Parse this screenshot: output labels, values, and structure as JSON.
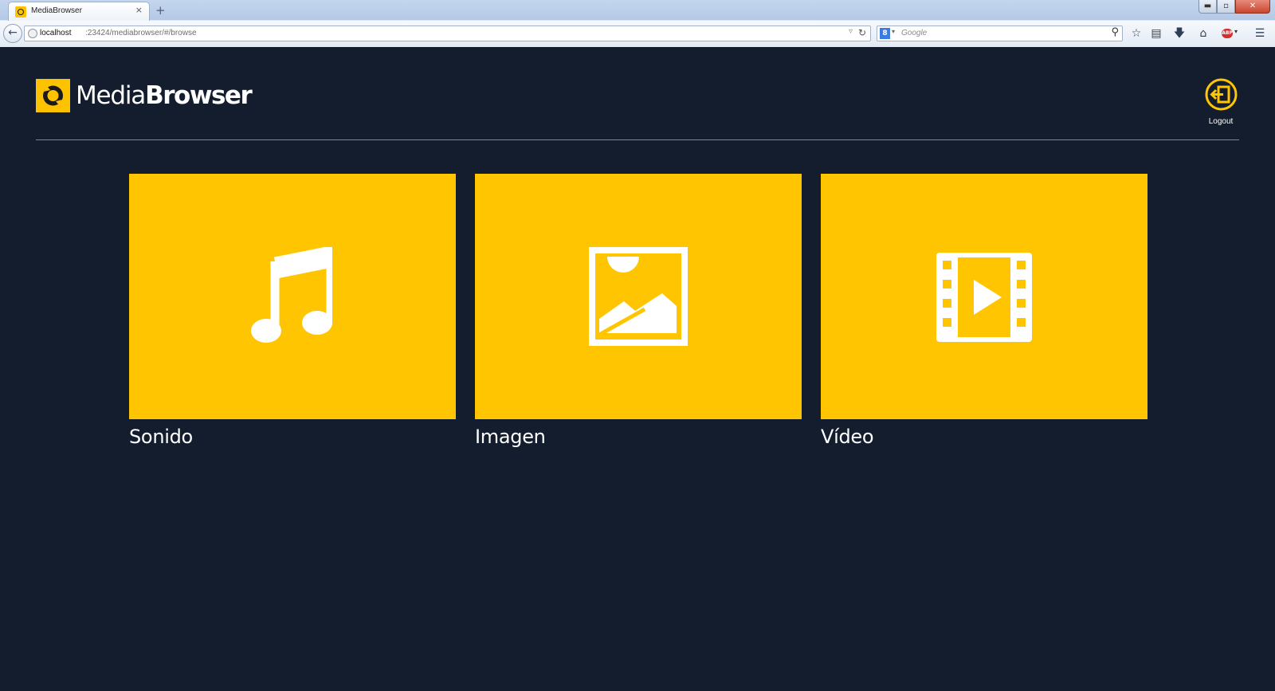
{
  "browser": {
    "tab_title": "MediaBrowser",
    "tab_close": "×",
    "new_tab": "+",
    "url_host": "localhost",
    "url_path": ":23424/mediabrowser/#/browse",
    "search_engine_badge": "8",
    "search_placeholder": "Google",
    "window_buttons": {
      "minimize": "▬",
      "maximize": "▫",
      "close": "✕"
    },
    "toolbar_icons": [
      "star-icon",
      "reading-list-icon",
      "download-icon",
      "home-icon",
      "adblock-icon",
      "menu-icon"
    ],
    "adblock_badge": "ABP"
  },
  "header": {
    "logo_light": "Media",
    "logo_bold": "Browser",
    "logout_label": "Logout"
  },
  "categories": [
    {
      "label": "Sonido",
      "icon": "music-note-icon"
    },
    {
      "label": "Imagen",
      "icon": "image-icon"
    },
    {
      "label": "Vídeo",
      "icon": "film-play-icon"
    }
  ],
  "colors": {
    "background": "#131d2e",
    "accent": "#fec500",
    "text": "#ffffff"
  }
}
